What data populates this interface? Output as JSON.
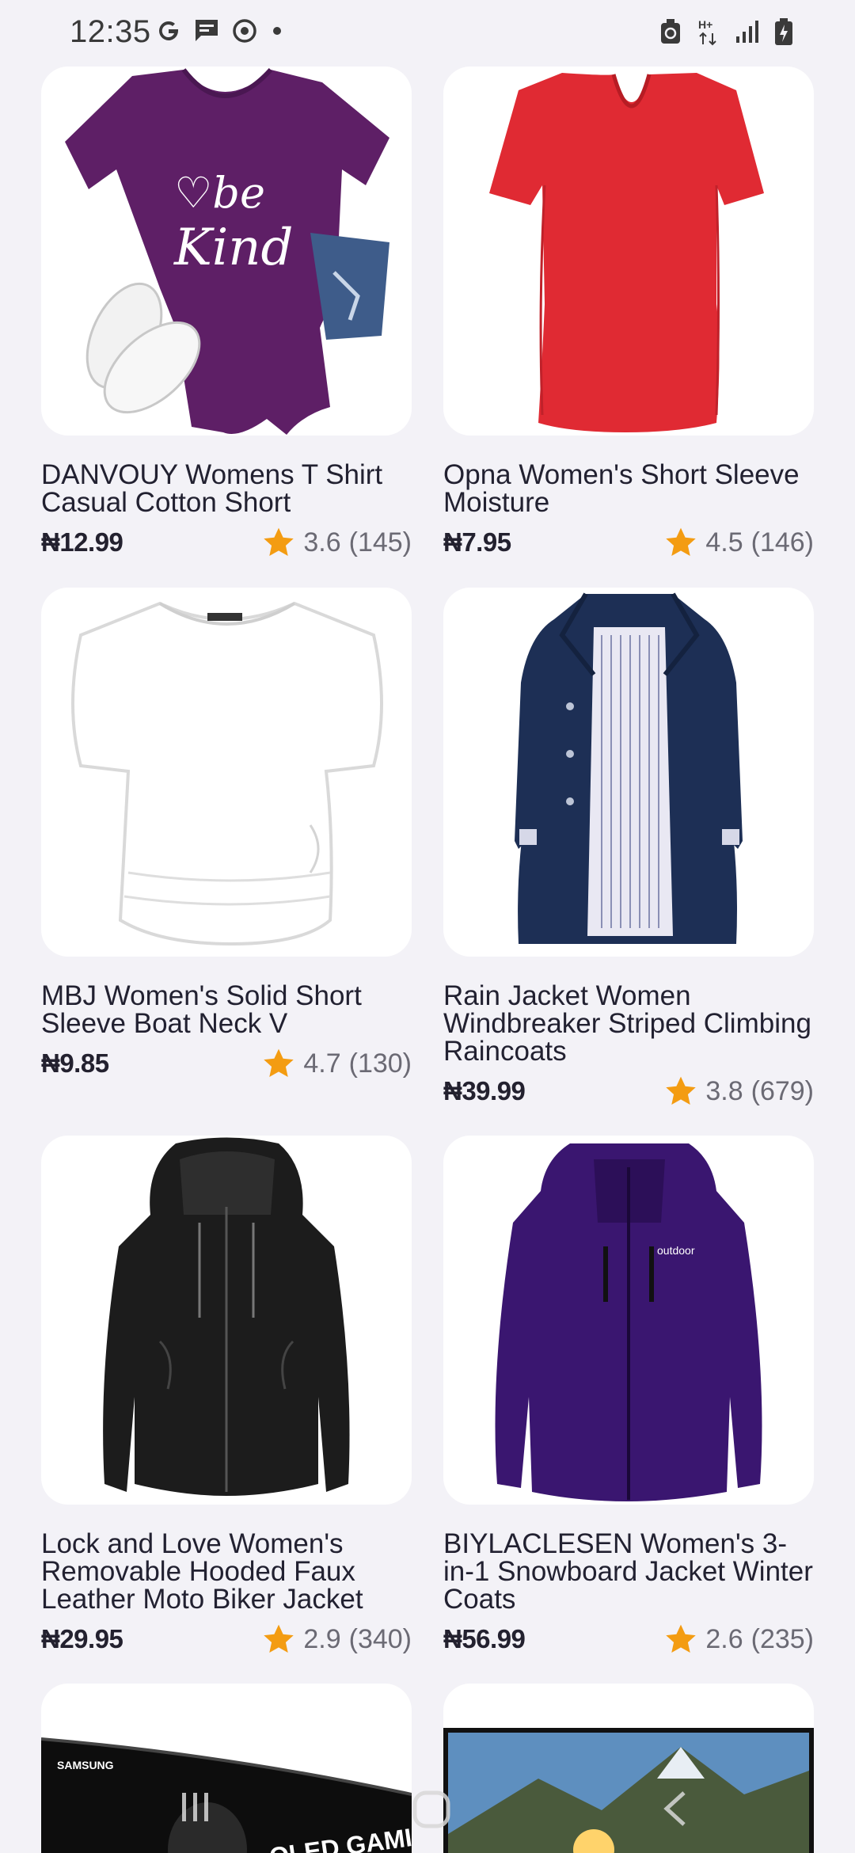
{
  "status_bar": {
    "time": "12:35",
    "left_icons": [
      "google-icon",
      "message-icon",
      "sync-icon",
      "dot-icon"
    ],
    "right_icons": [
      "recycle-icon",
      "hplus-data-icon",
      "signal-icon",
      "battery-icon"
    ],
    "network_label": "H+"
  },
  "products": [
    {
      "title": "DANVOUY Womens T Shirt Casual Cotton Short",
      "price": "₦12.99",
      "rating": "3.6",
      "reviews": "(145)",
      "image": "purple-tshirt",
      "logo_text": "be Kind"
    },
    {
      "title": "Opna Women's Short Sleeve Moisture",
      "price": "₦7.95",
      "rating": "4.5",
      "reviews": "(146)",
      "image": "red-tshirt"
    },
    {
      "title": "MBJ Women's Solid Short Sleeve Boat Neck V",
      "price": "₦9.85",
      "rating": "4.7",
      "reviews": "(130)",
      "image": "white-top"
    },
    {
      "title": "Rain Jacket Women Windbreaker Striped Climbing Raincoats",
      "price": "₦39.99",
      "rating": "3.8",
      "reviews": "(679)",
      "image": "navy-raincoat"
    },
    {
      "title": "Lock and Love Women's Removable Hooded Faux Leather Moto Biker Jacket",
      "price": "₦29.95",
      "rating": "2.9",
      "reviews": "(340)",
      "image": "black-leather-jacket"
    },
    {
      "title": "BIYLACLESEN Women's 3-in-1 Snowboard Jacket Winter Coats",
      "price": "₦56.99",
      "rating": "2.6",
      "reviews": "(235)",
      "image": "purple-snow-jacket"
    },
    {
      "title": "",
      "image": "samsung-monitor",
      "brand_text": "SAMSUNG",
      "badge_text": "QLED GAMING"
    },
    {
      "title": "",
      "image": "landscape-monitor"
    }
  ],
  "nav_bar": {
    "buttons": [
      "recent-apps-icon",
      "home-icon",
      "back-icon"
    ]
  },
  "colors": {
    "background": "#f3f2f7",
    "card": "#ffffff",
    "star": "#f39c12",
    "text": "#222131",
    "muted": "#6b6a74"
  }
}
